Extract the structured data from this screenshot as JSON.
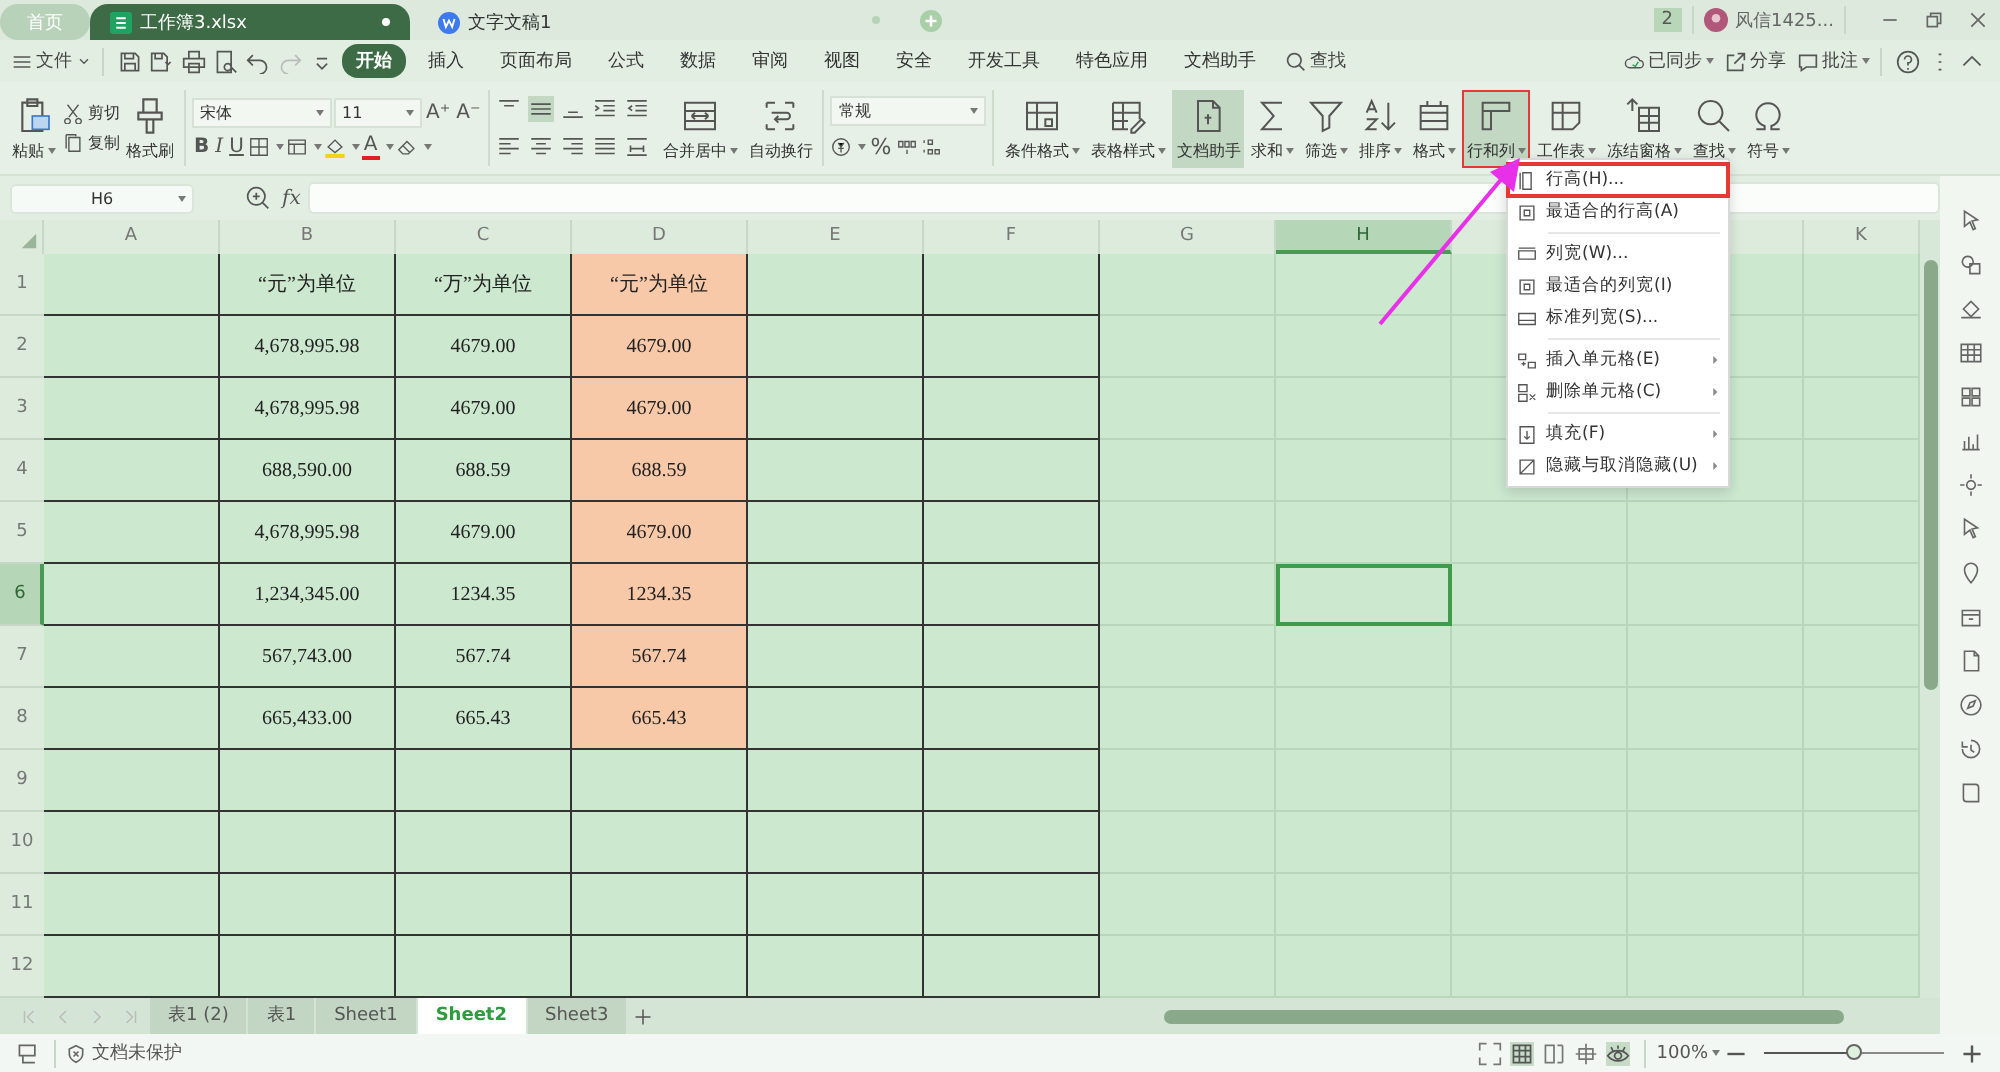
{
  "tabs": [
    {
      "label": "首页",
      "kind": "home",
      "selected": false,
      "modified": false
    },
    {
      "label": "工作簿3.xlsx",
      "kind": "sheet",
      "selected": true,
      "modified": true
    },
    {
      "label": "文字文稿1",
      "kind": "writer",
      "selected": false,
      "modified": false
    }
  ],
  "title_bar": {
    "badge": "2",
    "user": "风信1425..."
  },
  "menu": {
    "file": "文件",
    "items": [
      {
        "label": "开始",
        "selected": true
      },
      {
        "label": "插入",
        "selected": false
      },
      {
        "label": "页面布局",
        "selected": false
      },
      {
        "label": "公式",
        "selected": false
      },
      {
        "label": "数据",
        "selected": false
      },
      {
        "label": "审阅",
        "selected": false
      },
      {
        "label": "视图",
        "selected": false
      },
      {
        "label": "安全",
        "selected": false
      },
      {
        "label": "开发工具",
        "selected": false
      },
      {
        "label": "特色应用",
        "selected": false
      },
      {
        "label": "文档助手",
        "selected": false
      }
    ],
    "search": "查找",
    "sync": "已同步",
    "share": "分享",
    "comment": "批注"
  },
  "ribbon": {
    "paste": "粘贴",
    "cut": "剪切",
    "copy": "复制",
    "format_painter": "格式刷",
    "font": {
      "family": "宋体",
      "size": "11",
      "grow": "A⁺",
      "shrink": "A⁻",
      "styles": [
        "B",
        "I",
        "U"
      ],
      "color_glyph": "A"
    },
    "align": [
      {
        "kind": "top",
        "selected": false
      },
      {
        "kind": "middle",
        "selected": true
      },
      {
        "kind": "bottom",
        "selected": false
      },
      {
        "kind": "indent",
        "selected": false
      },
      {
        "kind": "outdent",
        "selected": false
      },
      {
        "kind": "left",
        "selected": false
      },
      {
        "kind": "center",
        "selected": false
      },
      {
        "kind": "right",
        "selected": false
      },
      {
        "kind": "justify",
        "selected": false
      },
      {
        "kind": "distributed",
        "selected": false
      }
    ],
    "merge": "合并居中",
    "wrap": "自动换行",
    "number_format": "常规",
    "percent": "%",
    "buttons": [
      {
        "label": "条件格式",
        "kind": "conditional",
        "dropdown": true,
        "selected": false,
        "outlined": false
      },
      {
        "label": "表格样式",
        "kind": "table_style",
        "dropdown": true,
        "selected": false,
        "outlined": false
      },
      {
        "label": "文档助手",
        "kind": "assistant",
        "dropdown": false,
        "selected": true,
        "outlined": false
      },
      {
        "label": "求和",
        "kind": "sum",
        "dropdown": true,
        "selected": false,
        "outlined": false
      },
      {
        "label": "筛选",
        "kind": "filter",
        "dropdown": true,
        "selected": false,
        "outlined": false
      },
      {
        "label": "排序",
        "kind": "sort",
        "dropdown": true,
        "selected": false,
        "outlined": false
      },
      {
        "label": "格式",
        "kind": "format",
        "dropdown": true,
        "selected": false,
        "outlined": false
      },
      {
        "label": "行和列",
        "kind": "rows_cols",
        "dropdown": true,
        "selected": true,
        "outlined": true
      },
      {
        "label": "工作表",
        "kind": "worksheet",
        "dropdown": true,
        "selected": false,
        "outlined": false
      },
      {
        "label": "冻结窗格",
        "kind": "freeze",
        "dropdown": true,
        "selected": false,
        "outlined": false
      },
      {
        "label": "查找",
        "kind": "find",
        "dropdown": true,
        "selected": false,
        "outlined": false
      },
      {
        "label": "符号",
        "kind": "symbol",
        "dropdown": true,
        "selected": false,
        "outlined": false
      }
    ]
  },
  "formula_bar": {
    "name_box": "H6",
    "fx": "fx"
  },
  "grid": {
    "columns": [
      {
        "label": "A",
        "bordered": true,
        "selected": false
      },
      {
        "label": "B",
        "bordered": true,
        "selected": false
      },
      {
        "label": "C",
        "bordered": true,
        "selected": false
      },
      {
        "label": "D",
        "bordered": true,
        "selected": false
      },
      {
        "label": "E",
        "bordered": true,
        "selected": false
      },
      {
        "label": "F",
        "bordered": true,
        "selected": false
      },
      {
        "label": "G",
        "bordered": false,
        "selected": false
      },
      {
        "label": "H",
        "bordered": false,
        "selected": true
      },
      {
        "bordered": false,
        "selected": false
      },
      {
        "bordered": false,
        "selected": false
      },
      {
        "label": "K",
        "bordered": false,
        "selected": false
      }
    ],
    "rows": [
      {
        "number": "1",
        "selected": false,
        "values": [
          {
            "text": "“元”为单位",
            "shaded": false
          },
          {
            "text": "“万”为单位",
            "shaded": false
          },
          {
            "text": "“元”为单位",
            "shaded": true
          }
        ]
      },
      {
        "number": "2",
        "selected": false,
        "values": [
          {
            "text": "4,678,995.98",
            "shaded": false
          },
          {
            "text": "4679.00",
            "shaded": false
          },
          {
            "text": "4679.00",
            "shaded": true
          }
        ]
      },
      {
        "number": "3",
        "selected": false,
        "values": [
          {
            "text": "4,678,995.98",
            "shaded": false
          },
          {
            "text": "4679.00",
            "shaded": false
          },
          {
            "text": "4679.00",
            "shaded": true
          }
        ]
      },
      {
        "number": "4",
        "selected": false,
        "values": [
          {
            "text": "688,590.00",
            "shaded": false
          },
          {
            "text": "688.59",
            "shaded": false
          },
          {
            "text": "688.59",
            "shaded": true
          }
        ]
      },
      {
        "number": "5",
        "selected": false,
        "values": [
          {
            "text": "4,678,995.98",
            "shaded": false
          },
          {
            "text": "4679.00",
            "shaded": false
          },
          {
            "text": "4679.00",
            "shaded": true
          }
        ]
      },
      {
        "number": "6",
        "selected": true,
        "values": [
          {
            "text": "1,234,345.00",
            "shaded": false
          },
          {
            "text": "1234.35",
            "shaded": false
          },
          {
            "text": "1234.35",
            "shaded": true
          }
        ]
      },
      {
        "number": "7",
        "selected": false,
        "values": [
          {
            "text": "567,743.00",
            "shaded": false
          },
          {
            "text": "567.74",
            "shaded": false
          },
          {
            "text": "567.74",
            "shaded": true
          }
        ]
      },
      {
        "number": "8",
        "selected": false,
        "values": [
          {
            "text": "665,433.00",
            "shaded": false
          },
          {
            "text": "665.43",
            "shaded": false
          },
          {
            "text": "665.43",
            "shaded": true
          }
        ]
      },
      {
        "number": "9",
        "selected": false
      },
      {
        "number": "10",
        "selected": false
      },
      {
        "number": "11",
        "selected": false
      },
      {
        "number": "12",
        "selected": false
      }
    ]
  },
  "context_menu": {
    "groups": [
      [
        {
          "label": "行高(H)...",
          "submenu": false,
          "highlighted": true
        },
        {
          "label": "最适合的行高(A)",
          "submenu": false,
          "highlighted": false
        }
      ],
      [
        {
          "label": "列宽(W)...",
          "submenu": false,
          "highlighted": false
        },
        {
          "label": "最适合的列宽(I)",
          "submenu": false,
          "highlighted": false
        },
        {
          "label": "标准列宽(S)...",
          "submenu": false,
          "highlighted": false
        }
      ],
      [
        {
          "label": "插入单元格(E)",
          "submenu": true,
          "highlighted": false
        },
        {
          "label": "删除单元格(C)",
          "submenu": true,
          "highlighted": false
        }
      ],
      [
        {
          "label": "填充(F)",
          "submenu": true,
          "highlighted": false
        },
        {
          "label": "隐藏与取消隐藏(U)",
          "submenu": true,
          "highlighted": false
        }
      ]
    ]
  },
  "sheet_tabs": [
    {
      "label": "表1 (2)",
      "selected": false
    },
    {
      "label": "表1",
      "selected": false
    },
    {
      "label": "Sheet1",
      "selected": false
    },
    {
      "label": "Sheet2",
      "selected": true
    },
    {
      "label": "Sheet3",
      "selected": false
    }
  ],
  "status_bar": {
    "protection": "文档未保护",
    "zoom": "100%",
    "level": 0.5
  }
}
